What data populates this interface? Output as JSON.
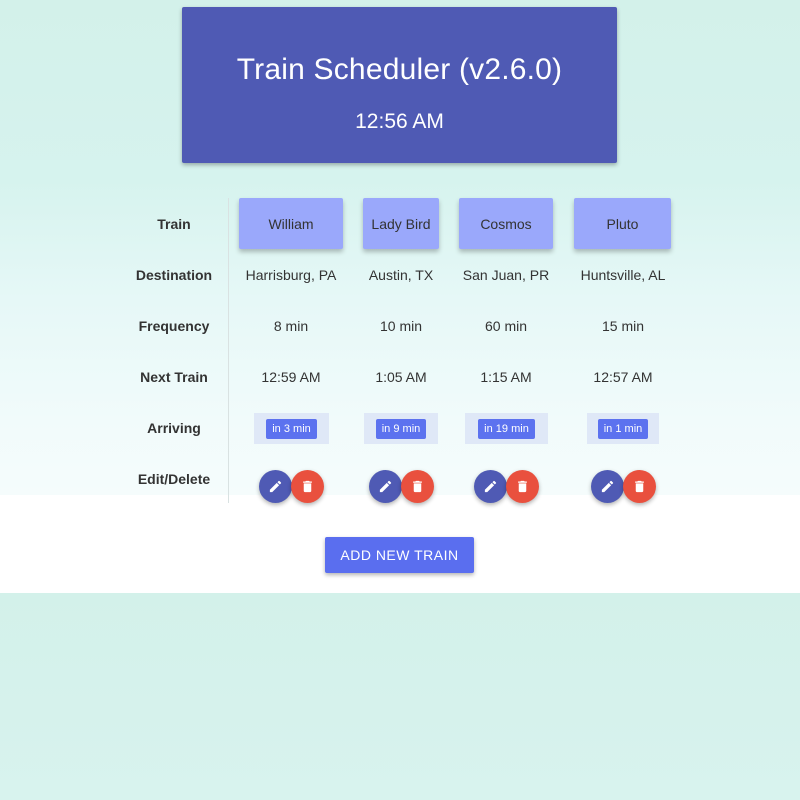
{
  "header": {
    "title": "Train Scheduler (v2.6.0)",
    "clock": "12:56 AM"
  },
  "row_labels": {
    "train": "Train",
    "destination": "Destination",
    "frequency": "Frequency",
    "next_train": "Next Train",
    "arriving": "Arriving",
    "edit_delete": "Edit/Delete"
  },
  "trains": [
    {
      "name": "William",
      "destination": "Harrisburg, PA",
      "frequency": "8 min",
      "next_train": "12:59 AM",
      "arriving": "in 3 min"
    },
    {
      "name": "Lady Bird",
      "destination": "Austin, TX",
      "frequency": "10 min",
      "next_train": "1:05 AM",
      "arriving": "in 9 min"
    },
    {
      "name": "Cosmos",
      "destination": "San Juan, PR",
      "frequency": "60 min",
      "next_train": "1:15 AM",
      "arriving": "in 19 min"
    },
    {
      "name": "Pluto",
      "destination": "Huntsville, AL",
      "frequency": "15 min",
      "next_train": "12:57 AM",
      "arriving": "in 1 min"
    }
  ],
  "actions": {
    "add_label": "ADD NEW TRAIN",
    "edit_icon": "pencil-icon",
    "delete_icon": "trash-icon"
  },
  "colors": {
    "header_bg": "#4f5ab4",
    "train_button_bg": "#9aa8fb",
    "arriving_badge": "#5c72ef",
    "edit_fab": "#4f5ab4",
    "delete_fab": "#e9503e",
    "add_button": "#5a6eef",
    "page_bg": "#d3f1ea"
  }
}
